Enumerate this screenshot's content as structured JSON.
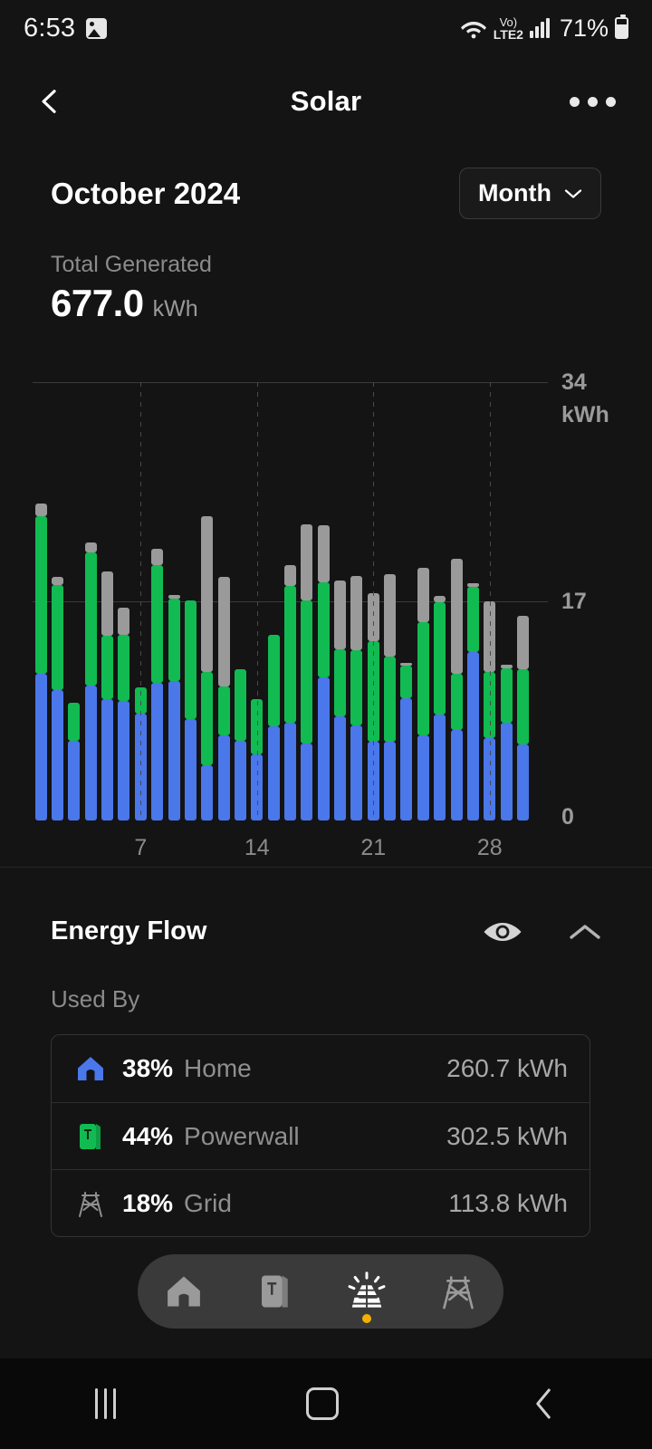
{
  "status_bar": {
    "time": "6:53",
    "image_icon": "image-icon",
    "wifi_icon": "wifi-icon",
    "volte_top": "Vo)",
    "volte_label": "LTE2",
    "signal_icon": "signal-bars-icon",
    "battery_percent": "71%"
  },
  "header": {
    "back_icon": "back-chevron-icon",
    "title": "Solar",
    "overflow_icon": "more-options-icon"
  },
  "summary": {
    "period_label": "October 2024",
    "period_selector": "Month",
    "chevron_icon": "chevron-down-icon",
    "total_label": "Total Generated",
    "total_value": "677.0",
    "total_unit": "kWh"
  },
  "chart_data": {
    "type": "bar",
    "title": "Solar generation by day - October 2024",
    "xlabel": "",
    "ylabel": "kWh",
    "ylim": [
      0,
      34
    ],
    "yticks": [
      0,
      17,
      34
    ],
    "ytick_labels": [
      "0",
      "17",
      "34"
    ],
    "y_unit_label": "kWh",
    "xticks": [
      7,
      14,
      21,
      28
    ],
    "xtick_labels": [
      "7",
      "14",
      "21",
      "28"
    ],
    "grid": "horizontal solid at 34 and 17, vertical dashed at 7/14/21/28",
    "stacked": true,
    "legend_position": "none",
    "series": [
      {
        "name": "Home",
        "color": "#4a77ea",
        "values": [
          11.4,
          10.1,
          6.2,
          10.5,
          9.4,
          9.3,
          8.3,
          10.7,
          10.8,
          7.9,
          4.3,
          6.6,
          6.2,
          5.1,
          7.3,
          7.6,
          6.0,
          11.1,
          8.1,
          7.4,
          6.1,
          6.1,
          9.5,
          6.6,
          8.2,
          7.0,
          13.1,
          6.4,
          7.6,
          5.9,
          0.0
        ]
      },
      {
        "name": "Powerwall",
        "color": "#11bb52",
        "values": [
          12.2,
          8.2,
          2.9,
          10.3,
          4.9,
          5.1,
          2.0,
          9.1,
          6.4,
          9.2,
          7.2,
          3.8,
          5.5,
          4.3,
          7.1,
          10.6,
          11.1,
          7.4,
          5.2,
          5.8,
          7.8,
          6.6,
          2.5,
          8.8,
          8.7,
          4.4,
          5.0,
          5.1,
          4.2,
          5.8,
          0.0
        ]
      },
      {
        "name": "Grid",
        "color": "#9a9a9a",
        "values": [
          1.0,
          0.6,
          0.0,
          0.8,
          5.0,
          2.1,
          0.0,
          1.3,
          0.3,
          0.0,
          12.1,
          8.5,
          0.0,
          0.0,
          0.0,
          1.6,
          5.9,
          4.4,
          5.3,
          5.8,
          3.7,
          6.4,
          0.2,
          4.2,
          0.5,
          8.9,
          0.3,
          5.5,
          0.3,
          4.2,
          0.0
        ]
      }
    ],
    "categories": [
      "1",
      "2",
      "3",
      "4",
      "5",
      "6",
      "7",
      "8",
      "9",
      "10",
      "11",
      "12",
      "13",
      "14",
      "15",
      "16",
      "17",
      "18",
      "19",
      "20",
      "21",
      "22",
      "23",
      "24",
      "25",
      "26",
      "27",
      "28",
      "29",
      "30",
      "31"
    ]
  },
  "energy_flow": {
    "title": "Energy Flow",
    "eye_icon": "eye-icon",
    "collapse_icon": "chevron-up-icon",
    "used_by_label": "Used By",
    "rows": [
      {
        "icon": "home-icon",
        "percent": "38%",
        "name": "Home",
        "value": "260.7 kWh",
        "color": "#4a77ea"
      },
      {
        "icon": "powerwall-icon",
        "percent": "44%",
        "name": "Powerwall",
        "value": "302.5 kWh",
        "color": "#11bb52"
      },
      {
        "icon": "grid-tower-icon",
        "percent": "18%",
        "name": "Grid",
        "value": "113.8 kWh",
        "color": "#8f8f8f"
      }
    ]
  },
  "tab_bar": {
    "items": [
      {
        "icon": "home-icon",
        "active": false
      },
      {
        "icon": "powerwall-icon",
        "active": false
      },
      {
        "icon": "solar-panel-icon",
        "active": true
      },
      {
        "icon": "grid-tower-icon",
        "active": false
      }
    ]
  },
  "android_nav": {
    "recents_icon": "recents-icon",
    "home_icon": "home-square-icon",
    "back_icon": "back-chevron-icon"
  }
}
